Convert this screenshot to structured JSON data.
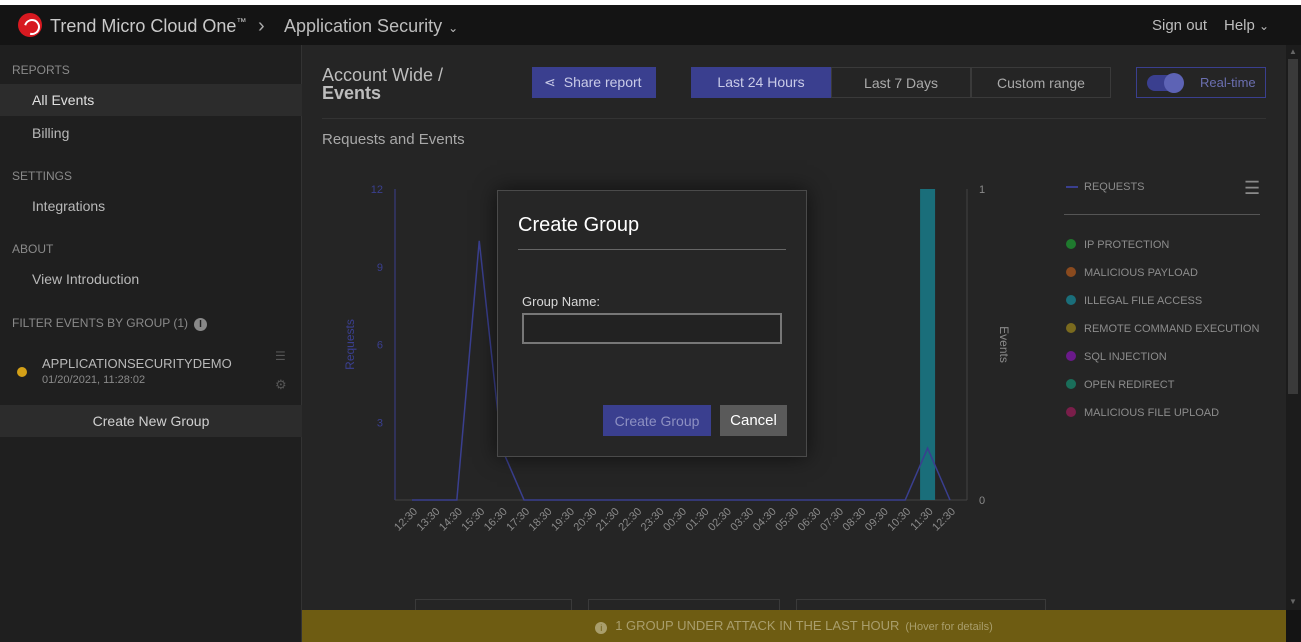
{
  "topbar": {
    "brand": "Trend Micro Cloud One",
    "brand_tm": "™",
    "separator": "›",
    "app": "Application Security",
    "signout": "Sign out",
    "help": "Help"
  },
  "sidebar": {
    "reports_header": "REPORTS",
    "all_events": "All Events",
    "billing": "Billing",
    "settings_header": "SETTINGS",
    "integrations": "Integrations",
    "about_header": "ABOUT",
    "view_intro": "View Introduction",
    "filter_header": "FILTER EVENTS BY GROUP (1)",
    "group": {
      "name": "APPLICATIONSECURITYDEMO",
      "date": "01/20/2021, 11:28:02",
      "status_color": "#d4a017"
    },
    "create_group": "Create New Group"
  },
  "main": {
    "title_line1": "Account Wide /",
    "title_line2": "Events",
    "share": "Share report",
    "ranges": [
      "Last 24 Hours",
      "Last 7 Days",
      "Custom range"
    ],
    "realtime": "Real-time",
    "section": "Requests and Events"
  },
  "chart_data": {
    "type": "line",
    "title": "Requests and Events",
    "ylabel": "Requests",
    "y2label": "Events",
    "ylim": [
      0,
      12
    ],
    "y2lim": [
      0,
      1
    ],
    "yticks": [
      3,
      6,
      9,
      12
    ],
    "y2ticks": [
      0,
      1
    ],
    "categories": [
      "12:30",
      "13:30",
      "14:30",
      "15:30",
      "16:30",
      "17:30",
      "18:30",
      "19:30",
      "20:30",
      "21:30",
      "22:30",
      "23:30",
      "00:30",
      "01:30",
      "02:30",
      "03:30",
      "04:30",
      "05:30",
      "06:30",
      "07:30",
      "08:30",
      "09:30",
      "10:30",
      "11:30",
      "12:30"
    ],
    "series": [
      {
        "name": "REQUESTS",
        "axis": "left",
        "color": "#3a3f8f",
        "values": [
          0,
          0,
          0,
          10,
          2,
          0,
          0,
          0,
          0,
          0,
          0,
          0,
          0,
          0,
          0,
          0,
          0,
          0,
          0,
          0,
          0,
          0,
          0,
          2,
          0
        ]
      },
      {
        "name": "ILLEGAL FILE ACCESS",
        "axis": "right",
        "type": "bar",
        "color": "#1a6e7a",
        "values": [
          0,
          0,
          0,
          0,
          0,
          0,
          0,
          0,
          0,
          0,
          0,
          0,
          0,
          0,
          0,
          0,
          0,
          0,
          0,
          0,
          0,
          0,
          0,
          1,
          0
        ]
      }
    ],
    "legend": [
      {
        "label": "REQUESTS",
        "color": "#3a3f8f"
      },
      {
        "label": "IP PROTECTION",
        "color": "#1f7a2e"
      },
      {
        "label": "MALICIOUS PAYLOAD",
        "color": "#8a4a1e"
      },
      {
        "label": "ILLEGAL FILE ACCESS",
        "color": "#1a6e7a"
      },
      {
        "label": "REMOTE COMMAND EXECUTION",
        "color": "#7a6a1e"
      },
      {
        "label": "SQL INJECTION",
        "color": "#6a1a8a"
      },
      {
        "label": "OPEN REDIRECT",
        "color": "#1a6e5a"
      },
      {
        "label": "MALICIOUS FILE UPLOAD",
        "color": "#7a1e4a"
      }
    ],
    "legend_position": "right"
  },
  "banner": {
    "text": "1 GROUP UNDER ATTACK IN THE LAST HOUR",
    "hint": "(Hover for details)",
    "icon": "i"
  },
  "modal": {
    "title": "Create Group",
    "field_label": "Group Name:",
    "field_value": "",
    "create": "Create Group",
    "cancel": "Cancel"
  }
}
